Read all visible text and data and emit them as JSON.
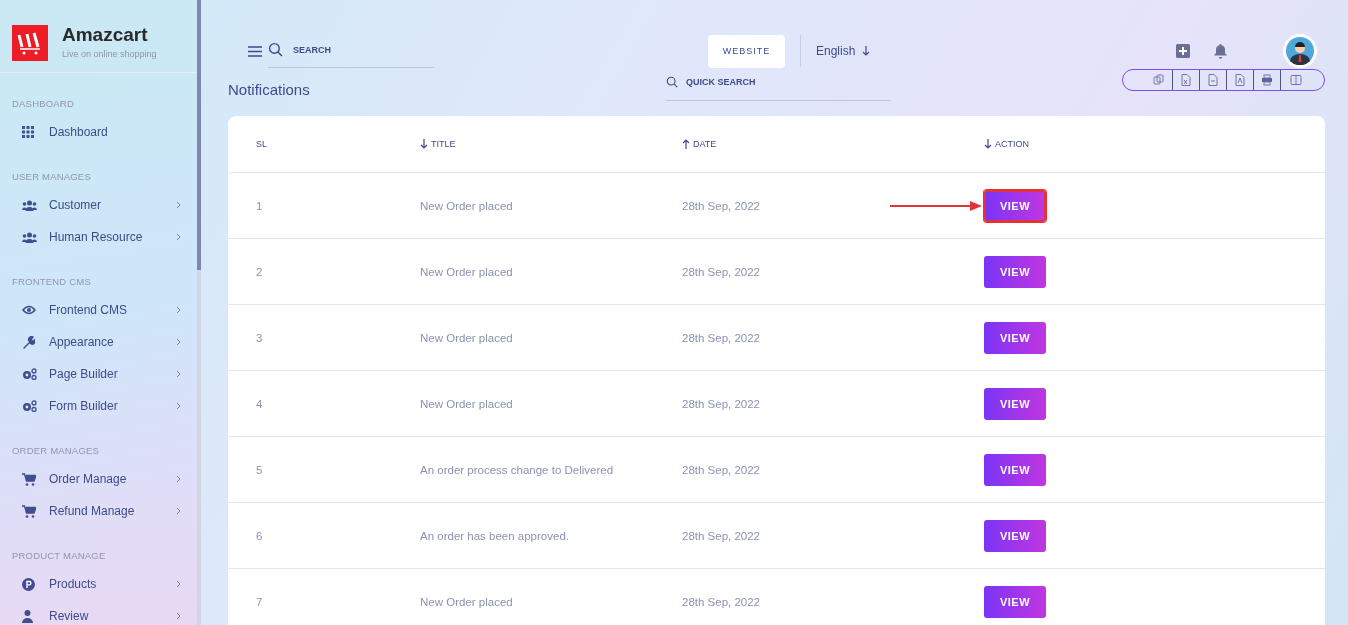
{
  "brand": {
    "name": "Amazcart",
    "tagline": "Live on online shopping"
  },
  "sidebar": {
    "sections": [
      {
        "heading": "DASHBOARD",
        "items": [
          {
            "label": "Dashboard",
            "expandable": false
          }
        ]
      },
      {
        "heading": "USER MANAGES",
        "items": [
          {
            "label": "Customer",
            "expandable": true
          },
          {
            "label": "Human Resource",
            "expandable": true
          }
        ]
      },
      {
        "heading": "FRONTEND CMS",
        "items": [
          {
            "label": "Frontend CMS",
            "expandable": true
          },
          {
            "label": "Appearance",
            "expandable": true
          },
          {
            "label": "Page Builder",
            "expandable": true
          },
          {
            "label": "Form Builder",
            "expandable": true
          }
        ]
      },
      {
        "heading": "ORDER MANAGES",
        "items": [
          {
            "label": "Order Manage",
            "expandable": true
          },
          {
            "label": "Refund Manage",
            "expandable": true
          }
        ]
      },
      {
        "heading": "PRODUCT MANAGE",
        "items": [
          {
            "label": "Products",
            "expandable": true
          },
          {
            "label": "Review",
            "expandable": true
          }
        ]
      }
    ]
  },
  "topbar": {
    "search": {
      "placeholder": "SEARCH"
    },
    "website_button": "WEBSITE",
    "language": "English"
  },
  "page_title": "Notifications",
  "quick_search": {
    "placeholder": "QUICK SEARCH"
  },
  "table": {
    "columns": [
      {
        "label": "SL",
        "sort_up": false,
        "sort_down": false
      },
      {
        "label": "TITLE",
        "sort_up": false,
        "sort_down": true
      },
      {
        "label": "DATE",
        "sort_up": true,
        "sort_down": false
      },
      {
        "label": "ACTION",
        "sort_up": false,
        "sort_down": true
      }
    ],
    "rows": [
      {
        "sl": "1",
        "title": "New Order placed",
        "date": "28th Sep, 2022",
        "action": "VIEW",
        "highlighted": true
      },
      {
        "sl": "2",
        "title": "New Order placed",
        "date": "28th Sep, 2022",
        "action": "VIEW",
        "highlighted": false
      },
      {
        "sl": "3",
        "title": "New Order placed",
        "date": "28th Sep, 2022",
        "action": "VIEW",
        "highlighted": false
      },
      {
        "sl": "4",
        "title": "New Order placed",
        "date": "28th Sep, 2022",
        "action": "VIEW",
        "highlighted": false
      },
      {
        "sl": "5",
        "title": "An order process change to Delivered",
        "date": "28th Sep, 2022",
        "action": "VIEW",
        "highlighted": false
      },
      {
        "sl": "6",
        "title": "An order has been approved.",
        "date": "28th Sep, 2022",
        "action": "VIEW",
        "highlighted": false
      },
      {
        "sl": "7",
        "title": "New Order placed",
        "date": "28th Sep, 2022",
        "action": "VIEW",
        "highlighted": false
      }
    ]
  }
}
